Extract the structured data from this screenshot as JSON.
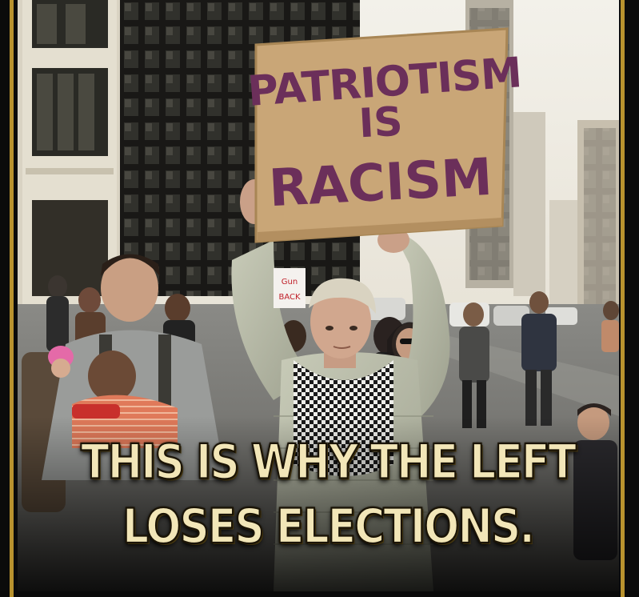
{
  "sign": {
    "line1": "PATRIOTISM",
    "line2": "IS",
    "line3": "RACISM"
  },
  "small_sign": {
    "line1": "Gun",
    "line2": "BACK"
  },
  "caption": {
    "line1": "THIS IS WHY THE LEFT",
    "line2": "LOSES ELECTIONS."
  },
  "colors": {
    "border": "#b8922e",
    "caption_text": "#f2e6b8",
    "sign_cardboard": "#c9a677",
    "sign_ink": "#6b2f5a"
  }
}
